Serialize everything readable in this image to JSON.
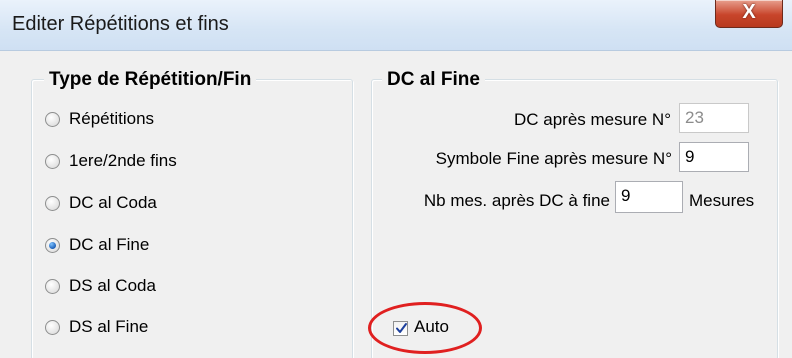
{
  "window": {
    "title": "Editer Répétitions et fins",
    "close_glyph": "X"
  },
  "left_group": {
    "title": "Type de Répétition/Fin",
    "options": [
      {
        "label": "Répétitions",
        "checked": false
      },
      {
        "label": "1ere/2nde fins",
        "checked": false
      },
      {
        "label": "DC al Coda",
        "checked": false
      },
      {
        "label": "DC al Fine",
        "checked": true
      },
      {
        "label": "DS al Coda",
        "checked": false
      },
      {
        "label": "DS al Fine",
        "checked": false
      }
    ]
  },
  "right_group": {
    "title": "DC al Fine",
    "dc_after_label": "DC après mesure N°",
    "dc_after_value": "23",
    "fine_after_label": "Symbole Fine après mesure N°",
    "fine_after_value": "9",
    "nb_after_label": "Nb mes. après DC à fine",
    "nb_after_value": "9",
    "nb_after_unit": "Mesures",
    "auto_label": "Auto",
    "auto_checked": true
  },
  "colors": {
    "highlight": "#e02020",
    "accent": "#1c5fb8"
  }
}
